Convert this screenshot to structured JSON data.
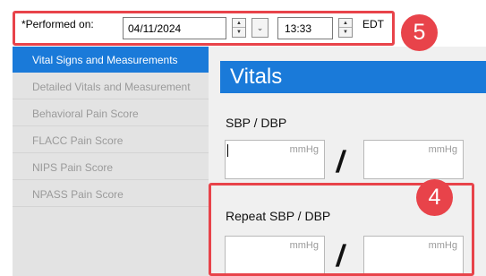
{
  "performed": {
    "label": "*Performed on:",
    "date": "04/11/2024",
    "time": "13:33",
    "timezone": "EDT"
  },
  "sidebar": {
    "items": [
      {
        "label": "Vital Signs and Measurements",
        "active": true
      },
      {
        "label": "Detailed Vitals and Measurement",
        "active": false
      },
      {
        "label": "Behavioral Pain Score",
        "active": false
      },
      {
        "label": "FLACC Pain Score",
        "active": false
      },
      {
        "label": "NIPS Pain Score",
        "active": false
      },
      {
        "label": "NPASS Pain Score",
        "active": false
      }
    ]
  },
  "main": {
    "section_title": "Vitals",
    "sbp_dbp_label": "SBP / DBP",
    "repeat_label": "Repeat SBP / DBP",
    "unit": "mmHg",
    "separator": "/"
  },
  "callouts": {
    "top": "5",
    "repeat": "4"
  },
  "colors": {
    "accent_blue": "#1a7ad9",
    "callout_red": "#e8434a",
    "sidebar_bg": "#e3e3e3",
    "panel_bg": "#f0f0f0"
  }
}
